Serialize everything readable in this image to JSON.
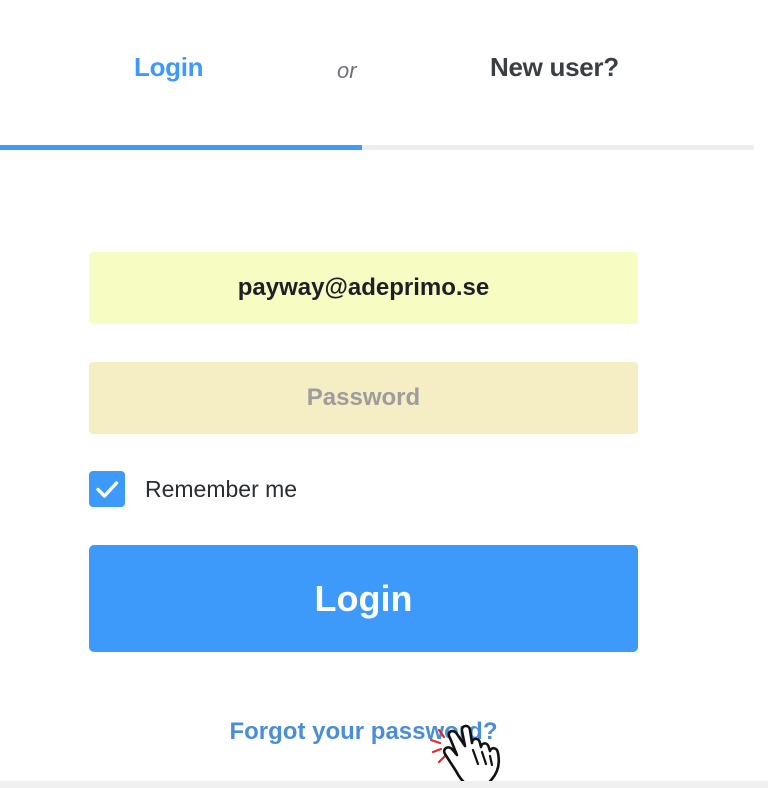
{
  "theme": {
    "accent": "#3d9afb",
    "email_bg": "#f7fdc2",
    "password_bg": "#f5edc3"
  },
  "tabs": {
    "login_label": "Login",
    "separator": "or",
    "new_user_label": "New user?",
    "active": "login",
    "active_fraction": 0.48
  },
  "form": {
    "email": {
      "value": "payway@adeprimo.se",
      "type": "email"
    },
    "password": {
      "value": "",
      "placeholder": "Password"
    },
    "remember_me": {
      "label": "Remember me",
      "checked": true
    },
    "submit_label": "Login",
    "forgot_label": "Forgot your password?"
  },
  "icons": {
    "checkbox": "checkmark-icon",
    "cursor": "hand-pointer-icon"
  }
}
